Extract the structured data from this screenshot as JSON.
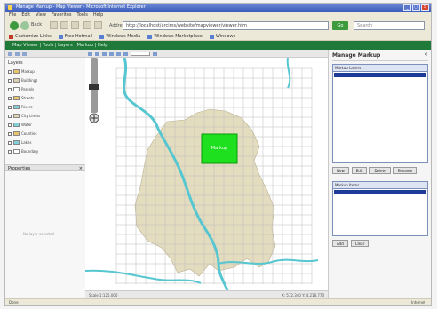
{
  "window": {
    "title": "Manage Markup - Map Viewer - Microsoft Internet Explorer"
  },
  "menu": [
    "File",
    "Edit",
    "View",
    "Favorites",
    "Tools",
    "Help"
  ],
  "nav": {
    "back_label": "Back",
    "address_label": "Address",
    "address": "http://localhost/arcims/website/mapviewer/viewer.htm",
    "go_label": "Go",
    "search_placeholder": "Search"
  },
  "links": [
    {
      "label": "Customize Links",
      "red": true
    },
    {
      "label": "Free Hotmail",
      "red": false
    },
    {
      "label": "Windows Media",
      "red": false
    },
    {
      "label": "Windows Marketplace",
      "red": false
    },
    {
      "label": "Windows",
      "red": false
    }
  ],
  "header_bar": "Map Viewer  |  Tools  |  Layers  |  Markup  |  Help",
  "left_panel": {
    "layers_label": "Layers",
    "layers": [
      {
        "label": "Markup",
        "color": "#e9c46a"
      },
      {
        "label": "Buildings",
        "color": "#d9d0b0"
      },
      {
        "label": "Parcels",
        "color": "#ffffff"
      },
      {
        "label": "Streets",
        "color": "#e9c46a"
      },
      {
        "label": "Rivers",
        "color": "#7fd0d8"
      },
      {
        "label": "City Limits",
        "color": "#e0d8b0"
      },
      {
        "label": "Water",
        "color": "#7fd0d8"
      },
      {
        "label": "Counties",
        "color": "#e9c46a"
      },
      {
        "label": "Lakes",
        "color": "#7fd0d8"
      },
      {
        "label": "Boundary",
        "color": "#ffffff"
      }
    ],
    "properties_label": "Properties",
    "properties_note": "No layer selected"
  },
  "map": {
    "selected_label": "Markup",
    "status_left": "Scale 1:125,000",
    "status_right": "X: 512,340  Y: 4,218,770",
    "colors": {
      "city": "#e3dcbf",
      "water": "#56c6d0",
      "grid": "#bdbdbd",
      "highlight": "#1ee01e"
    }
  },
  "right_panel": {
    "title": "Manage Markup",
    "close": "×",
    "list1_header": "Markup Layers",
    "list2_header": "Markup Items",
    "buttons1": [
      "New",
      "Edit",
      "Delete",
      "Rename"
    ],
    "buttons2": [
      "Add",
      "Clear"
    ]
  },
  "statusbar": {
    "left": "Done",
    "right": "Internet"
  }
}
